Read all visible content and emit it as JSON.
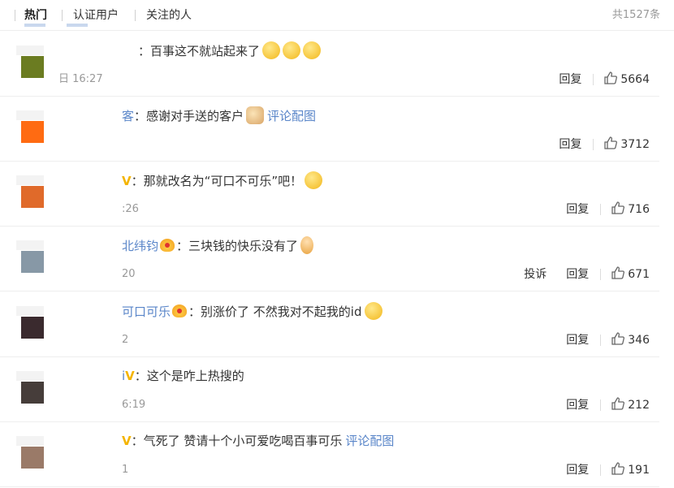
{
  "tabs": [
    {
      "label": "热门",
      "active": true
    },
    {
      "label": "认证用户",
      "active": false
    },
    {
      "label": "关注的人",
      "active": false
    }
  ],
  "total_count": "共1527条",
  "icons": {
    "like": "thumbs-up-icon",
    "verified": "yellow-v-badge-icon",
    "vip": "crown-icon"
  },
  "colors": {
    "link": "#5a86c9",
    "muted": "#999999",
    "badge": "#f4b400"
  },
  "comments": [
    {
      "username": "",
      "text": "百事这不就站起来了",
      "emojis": [
        "doge-face",
        "doge-face",
        "doge-face"
      ],
      "image_link": "",
      "timestamp": "日 16:27",
      "actions": [
        "回复"
      ],
      "likes": "5664",
      "avatar_color": "#6b7c21"
    },
    {
      "username": "客",
      "text": "感谢对手送的客户",
      "emojis": [
        "cat-face"
      ],
      "image_link": "评论配图",
      "timestamp": "",
      "actions": [
        "回复"
      ],
      "likes": "3712",
      "avatar_color": "#ff6b12"
    },
    {
      "username": "",
      "verified": true,
      "text": "那就改名为“可口不可乐”吧！",
      "emojis": [
        "laughing-face"
      ],
      "image_link": "",
      "timestamp": ":26",
      "actions": [
        "回复"
      ],
      "likes": "716",
      "avatar_color": "#e06a2a"
    },
    {
      "username": "北纬钧",
      "vip": true,
      "text": "三块钱的快乐没有了",
      "emojis": [
        "person-figure"
      ],
      "image_link": "",
      "timestamp": "20",
      "actions": [
        "投诉",
        "回复"
      ],
      "likes": "671",
      "avatar_color": "#8798a6"
    },
    {
      "username": "可口可乐",
      "vip": true,
      "text": "别涨价了 不然我对不起我的id",
      "emojis": [
        "pleading-face"
      ],
      "image_link": "",
      "timestamp": "2",
      "actions": [
        "回复"
      ],
      "likes": "346",
      "avatar_color": "#3a2a2e"
    },
    {
      "username": "i",
      "verified": true,
      "text": "这个是咋上热搜的",
      "emojis": [],
      "image_link": "",
      "timestamp": "6:19",
      "actions": [
        "回复"
      ],
      "likes": "212",
      "avatar_color": "#463d3a"
    },
    {
      "username": "",
      "verified": true,
      "text": "气死了 赞请十个小可爱吃喝百事可乐",
      "emojis": [],
      "image_link": "评论配图",
      "timestamp": "1",
      "actions": [
        "回复"
      ],
      "likes": "191",
      "avatar_color": "#9a7a68"
    }
  ]
}
